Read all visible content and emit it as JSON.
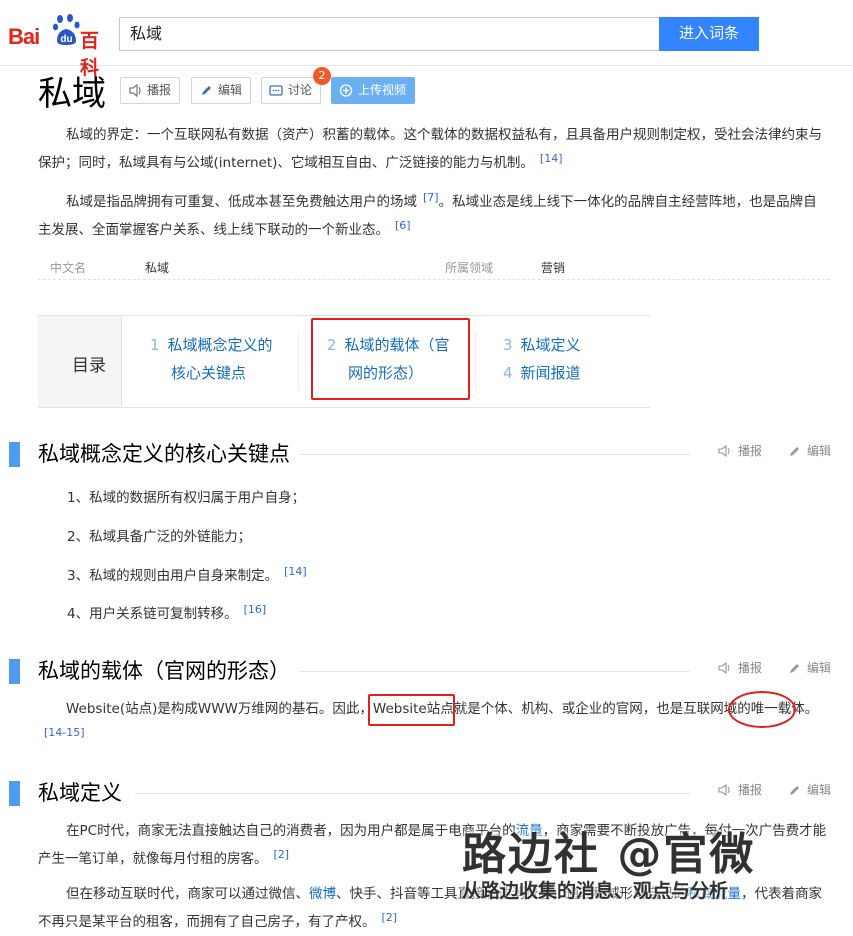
{
  "header": {
    "logo_text_left": "Bai",
    "logo_text_mid": "du",
    "logo_text_right": "百科",
    "search_value": "私域",
    "search_button": "进入词条"
  },
  "lemma": {
    "title": "私域",
    "buttons": {
      "report": "播报",
      "edit": "编辑",
      "discuss": "讨论",
      "upload": "上传视频"
    },
    "discuss_badge": "2"
  },
  "summary": {
    "p1": "私域的界定：一个互联网私有数据（资产）积蓄的载体。这个载体的数据权益私有，且具备用户规则制定权，受社会法律约束与保护；同时，私域具有与公域(internet)、它域相互自由、广泛链接的能力与机制。",
    "p1_ref": "[14]",
    "p2_a": "私域是指品牌拥有可重复、低成本甚至免费触达用户的场域",
    "p2_ref1": "[7]",
    "p2_b": "。私域业态是线上线下一体化的品牌自主经营阵地，也是品牌自主发展、全面掌握客户关系、线上线下联动的一个新业态。",
    "p2_ref2": "[6]"
  },
  "basic_info": {
    "label1": "中文名",
    "value1": "私域",
    "label2": "所属领域",
    "value2": "营销"
  },
  "catalog": {
    "heading": "目录",
    "items": [
      {
        "num": "1",
        "line1": "私域概念定义的",
        "line2": "核心关键点"
      },
      {
        "num": "2",
        "line1": "私域的载体（官",
        "line2": "网的形态）"
      },
      {
        "num": "3",
        "line1": "私域定义",
        "line2": ""
      },
      {
        "num": "4",
        "line1": "新闻报道",
        "line2": ""
      }
    ]
  },
  "section_actions": {
    "report": "播报",
    "edit": "编辑"
  },
  "sections": [
    {
      "title": "私域概念定义的核心关键点",
      "items": [
        {
          "text": "1、私域的数据所有权归属于用户自身；",
          "ref": ""
        },
        {
          "text": "2、私域具备广泛的外链能力；",
          "ref": ""
        },
        {
          "text": "3、私域的规则由用户自身来制定。",
          "ref": "[14]"
        },
        {
          "text": "4、用户关系链可复制转移。",
          "ref": "[16]"
        }
      ]
    },
    {
      "title": "私域的载体（官网的形态）",
      "p_a": "Website(站点)是构成WWW万维网的基石。因此，",
      "p_hl": "Website站点",
      "p_b": "就是个体、机构、或企业的官网，也是互联网域的唯一载体。",
      "ref": "[14-15]"
    },
    {
      "title": "私域定义",
      "p1_a": "在PC时代，商家无法直接触达自己的消费者，因为用户都是属于电商平台的",
      "p1_link": "流量",
      "p1_b": "，商家需要不断投放广告，每付一次广告费才能产生一笔订单，就像每月付租的房客。",
      "p1_ref": "[2]",
      "p2_a": "但在移动互联时代，商家可以通过微信、",
      "p2_link": "微博",
      "p2_b": "、快手、抖音等工具直接触达消费者，通过私域形成自己的",
      "p2_link2": "私域流量",
      "p2_c": "，代表着商家不再只是某平台的租客，而拥有了自己房子，有了产权。",
      "p2_ref": "[2]"
    }
  ],
  "watermark": {
    "line1": "路边社 @官微",
    "line2": "从路边收集的消息、观点与分析"
  },
  "colors": {
    "accent": "#3385ff",
    "link": "#136ec2",
    "annotation": "#e02020",
    "brand": "#e1251b"
  }
}
